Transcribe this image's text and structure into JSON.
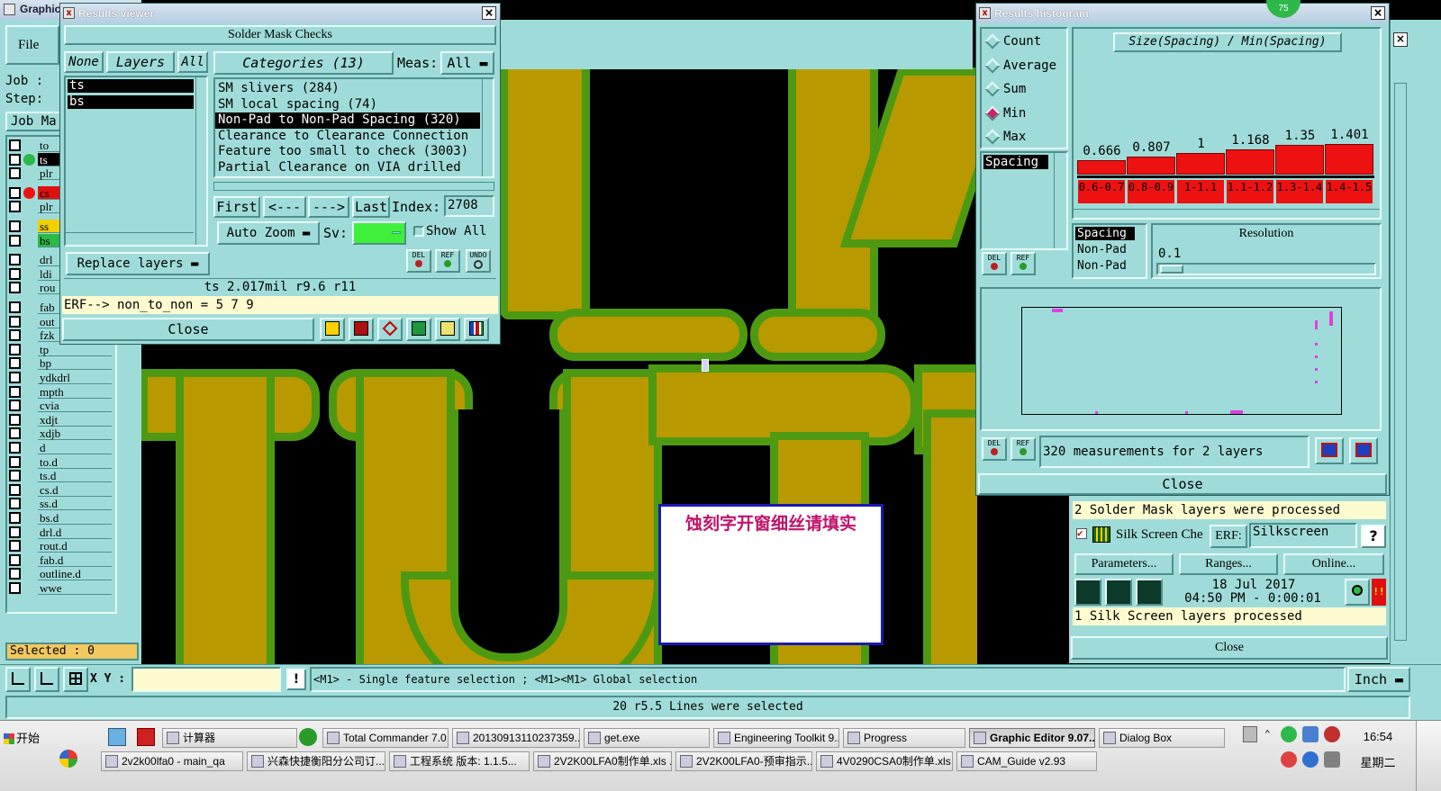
{
  "main_window": {
    "title": "Graphic",
    "menu_file": "File",
    "menu_other": "l",
    "job_label": "Job :",
    "step_label": "Step:",
    "job_button": "Job Ma",
    "selected_label": "Selected : 0",
    "xy_label": "X Y :",
    "xy_value": "",
    "hint_text": "<M1> - Single feature selection ; <M1><M1> Global selection",
    "units": "Inch",
    "status": "20 r5.5 Lines were selected",
    "layers": [
      "to",
      "ts",
      "plr",
      "cs",
      "plr",
      "ss",
      "bs",
      "drl",
      "ldi",
      "rou",
      "fab",
      "out",
      "fzk",
      "tp",
      "bp",
      "ydkdrl",
      "mpth",
      "cvia",
      "xdjt",
      "xdjb",
      "d",
      "to.d",
      "ts.d",
      "cs.d",
      "ss.d",
      "bs.d",
      "drl.d",
      "rout.d",
      "fab.d",
      "outline.d",
      "wwe"
    ]
  },
  "results_viewer": {
    "title": "Results viewer",
    "heading": "Solder Mask Checks",
    "btn_none": "None",
    "btn_layers": "Layers",
    "btn_all": "All",
    "categories_header": "Categories (13)",
    "meas_label": "Meas:",
    "meas_value": "All",
    "layers": [
      "ts",
      "bs"
    ],
    "categories": [
      "SM slivers (284)",
      "SM local spacing (74)",
      "Non-Pad to Non-Pad Spacing (320)",
      "Clearance to Clearance Connection",
      "Feature too small to check (3003)",
      "Partial Clearance on VIA drilled"
    ],
    "selected_category_index": 2,
    "nav_first": "First",
    "nav_prev": "<---",
    "nav_next": "--->",
    "nav_last": "Last",
    "index_label": "Index:",
    "index_value": "2708",
    "auto_zoom": "Auto Zoom",
    "sv_label": "Sv:",
    "show_all": "Show All",
    "replace_layers": "Replace layers",
    "icon_del": "DEL",
    "icon_ref": "REF",
    "icon_undo": "UNDO",
    "info_line": "ts 2.017mil  r9.6  r11",
    "erf_line": "ERF--> non_to_non = 5 7 9",
    "close": "Close"
  },
  "histogram": {
    "title": "Results histogram",
    "options": [
      "Count",
      "Average",
      "Sum",
      "Min",
      "Max"
    ],
    "selected_option": "Min",
    "left_list_item": "Spacing",
    "chart_title": "Size(Spacing) / Min(Spacing)",
    "bar_values": [
      "0.666",
      "0.807",
      "1",
      "1.168",
      "1.35",
      "1.401"
    ],
    "bar_ranges": [
      "0.6-0.7",
      "0.8-0.9",
      "1-1.1",
      "1.1-1.2",
      "1.3-1.4",
      "1.4-1.5"
    ],
    "resolution_items": [
      "Spacing",
      "Non-Pad",
      "Non-Pad"
    ],
    "resolution_label": "Resolution",
    "resolution_value": "0.1",
    "measurements": "320 measurements for 2 layers",
    "icon_del": "DEL",
    "icon_ref": "REF",
    "close": "Close",
    "badge": "75"
  },
  "checklist_panel": {
    "solder_msg": "2 Solder Mask layers were processed",
    "silk_label": "Silk Screen Che",
    "erf_label": "ERF:",
    "erf_value": "Silkscreen",
    "help": "?",
    "parameters": "Parameters...",
    "ranges": "Ranges...",
    "online": "Online...",
    "date": "18 Jul 2017",
    "time": "04:50 PM - 0:00:01",
    "silk_msg": "1 Silk Screen layers processed",
    "close": "Close",
    "alert": "!!"
  },
  "note_box": {
    "text": "蚀刻字开窗细丝请填实"
  },
  "taskbar": {
    "start": "开始",
    "row1": [
      {
        "label": "计算器"
      },
      {
        "label": "Total Commander 7.0..."
      },
      {
        "label": "20130913110237359..."
      },
      {
        "label": "get.exe"
      },
      {
        "label": "Engineering Toolkit 9...."
      },
      {
        "label": "Progress"
      },
      {
        "label": "Graphic Editor 9.07...",
        "active": true
      },
      {
        "label": "Dialog Box"
      }
    ],
    "row2": [
      {
        "label": "2v2k00lfa0 - main_qa"
      },
      {
        "label": "兴森快捷衡阳分公司订..."
      },
      {
        "label": "工程系统  版本: 1.1.5..."
      },
      {
        "label": "2V2K00LFA0制作单.xls ..."
      },
      {
        "label": "2V2K00LFA0-预审指示...."
      },
      {
        "label": "4V0290CSA0制作单.xls ..."
      },
      {
        "label": "CAM_Guide v2.93"
      }
    ],
    "clock": "16:54",
    "weekday": "星期二"
  }
}
